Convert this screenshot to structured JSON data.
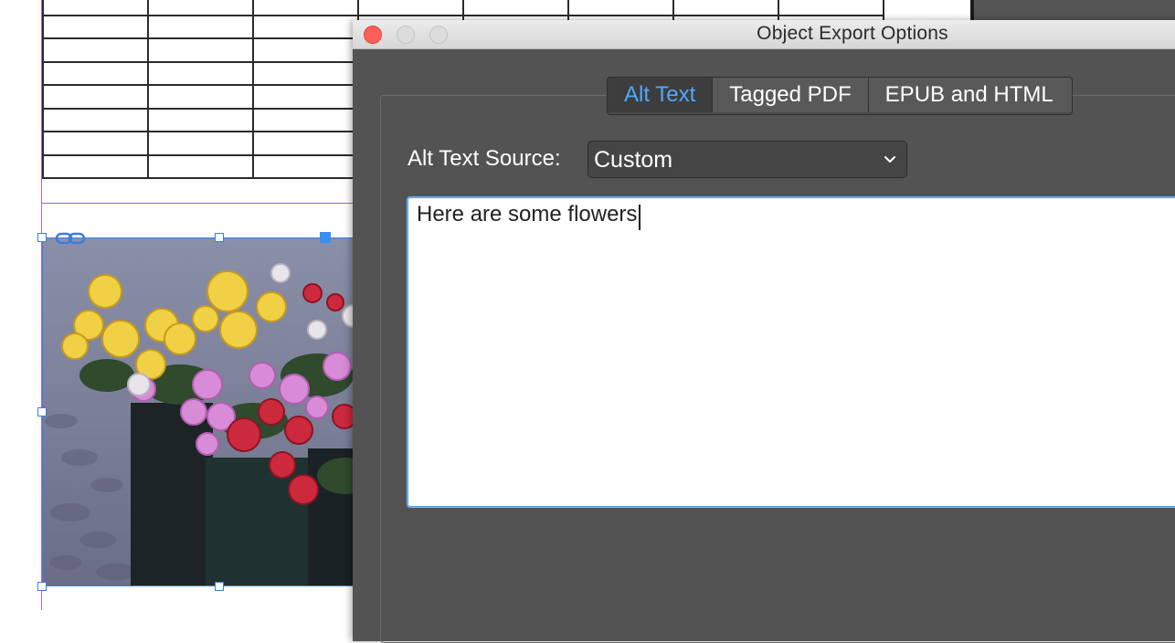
{
  "dialog": {
    "title": "Object Export Options",
    "window_controls": [
      "close",
      "minimize",
      "zoom"
    ],
    "tabs": [
      {
        "label": "Alt Text",
        "active": true
      },
      {
        "label": "Tagged PDF",
        "active": false
      },
      {
        "label": "EPUB and HTML",
        "active": false
      }
    ],
    "alt_text_source": {
      "label": "Alt Text Source:",
      "selected": "Custom"
    },
    "alt_text": {
      "value": "Here are some flowers"
    }
  },
  "document": {
    "table": {
      "visible_rows": 8,
      "visible_columns": 8
    },
    "image": {
      "subject": "painted flowers bouquet",
      "link_icon": "link-icon"
    }
  },
  "colors": {
    "dialog_bg": "#535353",
    "active_tab_text": "#4fa8ff",
    "selection_blue": "#3a8ef0",
    "close_button": "#fc5f57"
  }
}
